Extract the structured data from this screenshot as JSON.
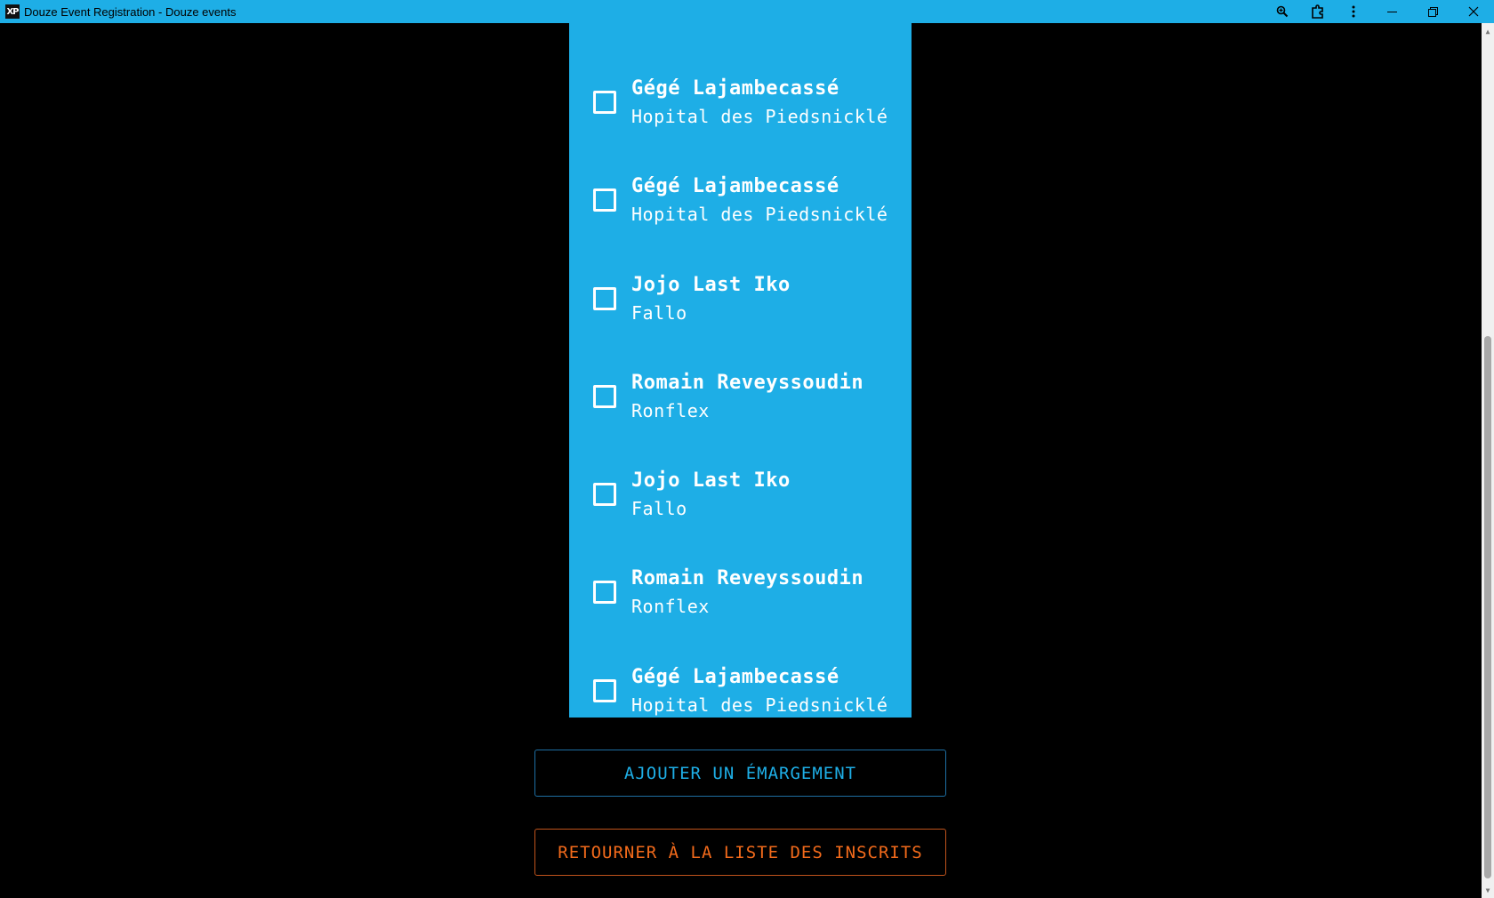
{
  "window": {
    "title": "Douze Event Registration - Douze events",
    "logo_text": "XP",
    "colors": {
      "titlebar": "#1eaee6",
      "panel": "#1eaee6",
      "background": "#000000"
    },
    "icons": [
      "zoom-icon",
      "extensions-icon",
      "kebab-menu-icon",
      "minimize-icon",
      "restore-icon",
      "close-icon"
    ]
  },
  "attendees": [
    {
      "name": "Gégé Lajambecassé",
      "organization": "Hopital des Piedsnicklé",
      "checked": false
    },
    {
      "name": "Gégé Lajambecassé",
      "organization": "Hopital des Piedsnicklé",
      "checked": false
    },
    {
      "name": "Jojo Last Iko",
      "organization": "Fallo",
      "checked": false
    },
    {
      "name": "Romain Reveyssoudin",
      "organization": "Ronflex",
      "checked": false
    },
    {
      "name": "Jojo Last Iko",
      "organization": "Fallo",
      "checked": false
    },
    {
      "name": "Romain Reveyssoudin",
      "organization": "Ronflex",
      "checked": false
    },
    {
      "name": "Gégé Lajambecassé",
      "organization": "Hopital des Piedsnicklé",
      "checked": false
    }
  ],
  "actions": {
    "add_label": "AJOUTER UN ÉMARGEMENT",
    "back_label": "RETOURNER À LA LISTE DES INSCRITS",
    "add_color": "#1eaee6",
    "back_color": "#f26a1b"
  }
}
